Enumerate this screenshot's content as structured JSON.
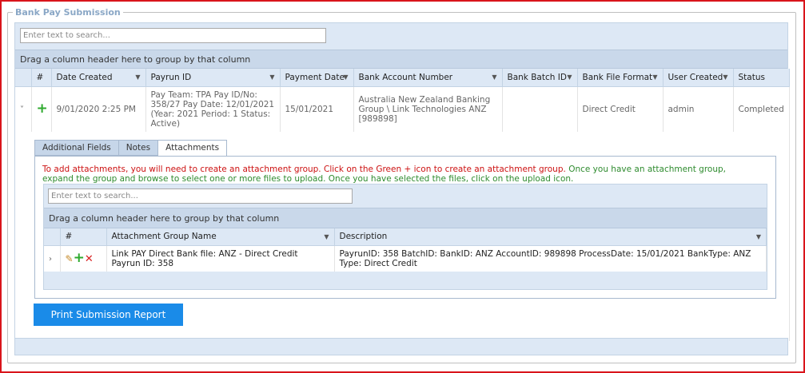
{
  "panel": {
    "title": "Bank Pay Submission"
  },
  "main_grid": {
    "search_placeholder": "Enter text to search...",
    "group_hint": "Drag a column header here to group by that column",
    "columns": [
      "#",
      "Date Created",
      "Payrun ID",
      "Payment Date",
      "Bank Account Number",
      "Bank Batch ID",
      "Bank File Format",
      "User Created",
      "Status"
    ],
    "row": {
      "date_created": "9/01/2020 2:25 PM",
      "payrun_id": "Pay Team: TPA Pay ID/No: 358/27 Pay Date: 12/01/2021 (Year: 2021 Period: 1 Status: Active)",
      "payment_date": "15/01/2021",
      "bank_account": "Australia New Zealand Banking Group \\ Link Technologies ANZ [989898]",
      "bank_batch_id": "",
      "bank_file_format": "Direct Credit",
      "user_created": "admin",
      "status": "Completed"
    }
  },
  "tabs": [
    "Additional Fields",
    "Notes",
    "Attachments"
  ],
  "attachments": {
    "message_red": "To add attachments, you will need to create an attachment group. Click on the Green + icon to create an attachment group.",
    "message_green": "Once you have an attachment group, expand the group and browse to select one or more files to upload. Once you have selected the files, click on the upload icon.",
    "search_placeholder": "Enter text to search...",
    "group_hint": "Drag a column header here to group by that column",
    "columns": [
      "#",
      "Attachment Group Name",
      "Description"
    ],
    "row": {
      "name": "Link PAY Direct Bank file: ANZ - Direct Credit Payrun ID: 358",
      "description": "PayrunID: 358 BatchID: BankID: ANZ AccountID: 989898 ProcessDate: 15/01/2021 BankType: ANZ Type: Direct Credit"
    }
  },
  "print_button": "Print Submission Report",
  "icons": {
    "add": "plus-icon",
    "edit": "pencil-icon",
    "delete": "close-icon",
    "expand": "chevron-right-icon",
    "collapse": "chevron-down-icon",
    "filter": "filter-icon"
  },
  "colors": {
    "accent": "#1a8be8",
    "border": "#d9141b",
    "add": "#2eaa2e",
    "delete": "#d92020"
  }
}
